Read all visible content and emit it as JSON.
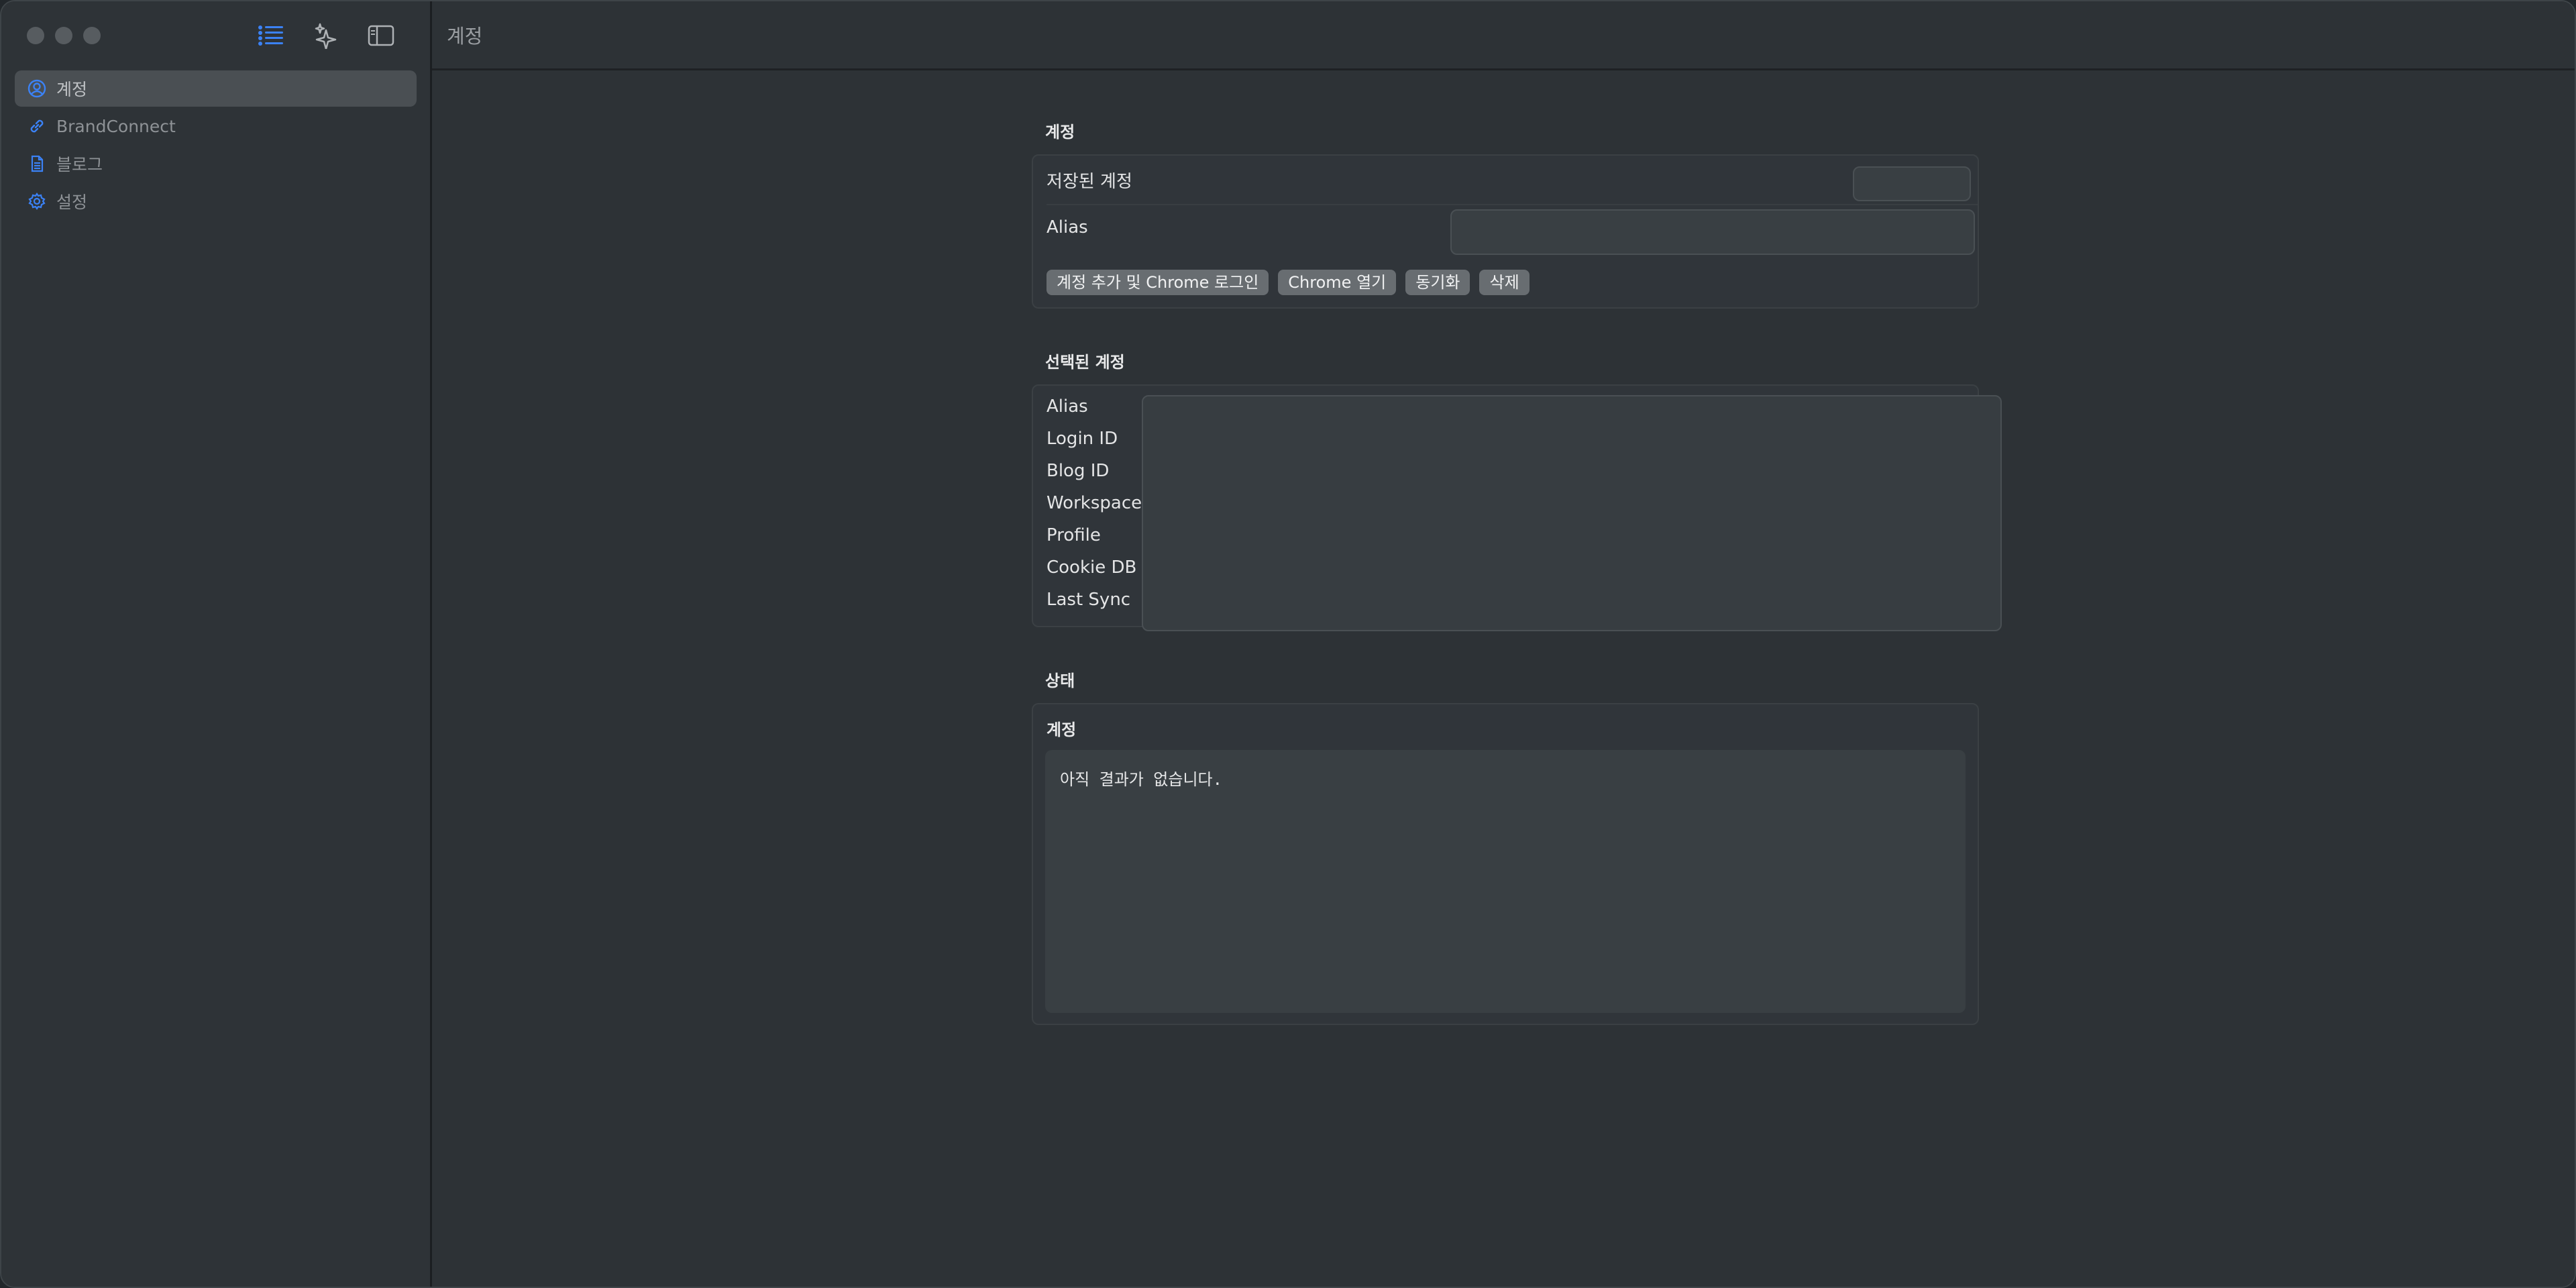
{
  "window": {
    "title": "계정"
  },
  "sidebar": {
    "toolbar": [
      {
        "icon": "list-icon",
        "active": true
      },
      {
        "icon": "sparkle-icon",
        "active": false
      },
      {
        "icon": "sidebar-toggle-icon",
        "active": false
      }
    ],
    "items": [
      {
        "label": "계정",
        "icon": "person-circle-icon",
        "active": true
      },
      {
        "label": "BrandConnect",
        "icon": "link-icon",
        "active": false
      },
      {
        "label": "블로그",
        "icon": "document-icon",
        "active": false
      },
      {
        "label": "설정",
        "icon": "gear-icon",
        "active": false
      }
    ]
  },
  "accounts_section": {
    "title": "계정",
    "saved_accounts_label": "저장된 계정",
    "saved_accounts_value": "",
    "alias_label": "Alias",
    "alias_value": "",
    "buttons": {
      "add_login": "계정 추가 및 Chrome 로그인",
      "open_chrome": "Chrome 열기",
      "sync": "동기화",
      "delete": "삭제"
    }
  },
  "selected_section": {
    "title": "선택된 계정",
    "labels": [
      "Alias",
      "Login ID",
      "Blog ID",
      "Workspace",
      "Profile",
      "Cookie DB",
      "Last Sync"
    ]
  },
  "status_section": {
    "title": "상태",
    "group_title": "계정",
    "output_text": "아직 결과가 없습니다."
  },
  "colors": {
    "accent": "#3b82f6",
    "background": "#2d3236",
    "sidebar": "#2e3337"
  }
}
